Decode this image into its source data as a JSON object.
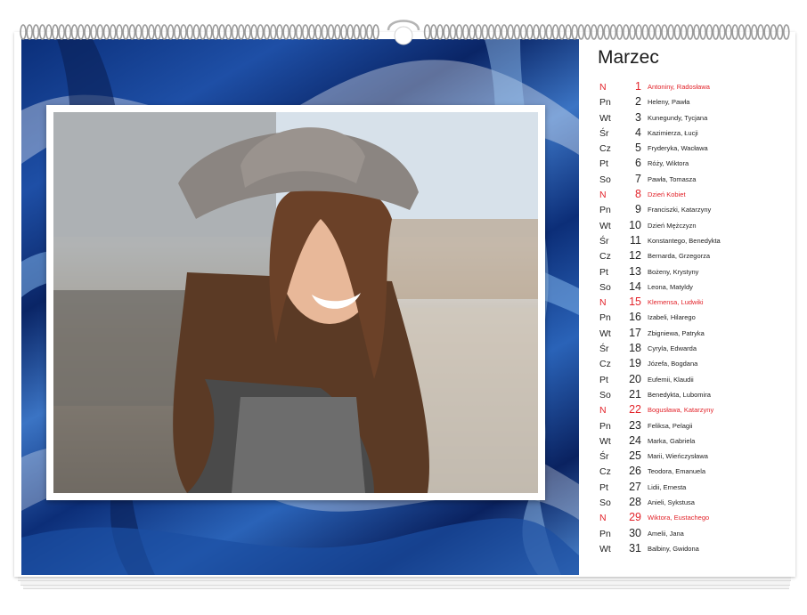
{
  "calendar": {
    "month": "Marzec",
    "days": [
      {
        "weekday": "N",
        "day": "1",
        "names": "Antoniny, Radosława",
        "holiday": true
      },
      {
        "weekday": "Pn",
        "day": "2",
        "names": "Heleny, Pawła",
        "holiday": false
      },
      {
        "weekday": "Wt",
        "day": "3",
        "names": "Kunegundy, Tycjana",
        "holiday": false
      },
      {
        "weekday": "Śr",
        "day": "4",
        "names": "Kazimierza, Łucji",
        "holiday": false
      },
      {
        "weekday": "Cz",
        "day": "5",
        "names": "Fryderyka, Wacława",
        "holiday": false
      },
      {
        "weekday": "Pt",
        "day": "6",
        "names": "Róży, Wiktora",
        "holiday": false
      },
      {
        "weekday": "So",
        "day": "7",
        "names": "Pawła, Tomasza",
        "holiday": false
      },
      {
        "weekday": "N",
        "day": "8",
        "names": "Dzień Kobiet",
        "holiday": true
      },
      {
        "weekday": "Pn",
        "day": "9",
        "names": "Franciszki, Katarzyny",
        "holiday": false
      },
      {
        "weekday": "Wt",
        "day": "10",
        "names": "Dzień Mężczyzn",
        "holiday": false
      },
      {
        "weekday": "Śr",
        "day": "11",
        "names": "Konstantego, Benedykta",
        "holiday": false
      },
      {
        "weekday": "Cz",
        "day": "12",
        "names": "Bernarda, Grzegorza",
        "holiday": false
      },
      {
        "weekday": "Pt",
        "day": "13",
        "names": "Bożeny, Krystyny",
        "holiday": false
      },
      {
        "weekday": "So",
        "day": "14",
        "names": "Leona, Matyldy",
        "holiday": false
      },
      {
        "weekday": "N",
        "day": "15",
        "names": "Klemensa, Ludwiki",
        "holiday": true
      },
      {
        "weekday": "Pn",
        "day": "16",
        "names": "Izabeli, Hilarego",
        "holiday": false
      },
      {
        "weekday": "Wt",
        "day": "17",
        "names": "Zbigniewa, Patryka",
        "holiday": false
      },
      {
        "weekday": "Śr",
        "day": "18",
        "names": "Cyryla, Edwarda",
        "holiday": false
      },
      {
        "weekday": "Cz",
        "day": "19",
        "names": "Józefa, Bogdana",
        "holiday": false
      },
      {
        "weekday": "Pt",
        "day": "20",
        "names": "Eufemii, Klaudii",
        "holiday": false
      },
      {
        "weekday": "So",
        "day": "21",
        "names": "Benedykta, Lubomira",
        "holiday": false
      },
      {
        "weekday": "N",
        "day": "22",
        "names": "Bogusława, Katarzyny",
        "holiday": true
      },
      {
        "weekday": "Pn",
        "day": "23",
        "names": "Feliksa, Pelagii",
        "holiday": false
      },
      {
        "weekday": "Wt",
        "day": "24",
        "names": "Marka, Gabriela",
        "holiday": false
      },
      {
        "weekday": "Śr",
        "day": "25",
        "names": "Marii, Wieńczysława",
        "holiday": false
      },
      {
        "weekday": "Cz",
        "day": "26",
        "names": "Teodora, Emanuela",
        "holiday": false
      },
      {
        "weekday": "Pt",
        "day": "27",
        "names": "Lidii, Ernesta",
        "holiday": false
      },
      {
        "weekday": "So",
        "day": "28",
        "names": "Anieli, Sykstusa",
        "holiday": false
      },
      {
        "weekday": "N",
        "day": "29",
        "names": "Wiktora, Eustachego",
        "holiday": true
      },
      {
        "weekday": "Pn",
        "day": "30",
        "names": "Amelii, Jana",
        "holiday": false
      },
      {
        "weekday": "Wt",
        "day": "31",
        "names": "Balbiny, Gwidona",
        "holiday": false
      }
    ]
  },
  "colors": {
    "holiday": "#e2232a",
    "text": "#222222",
    "marble_dark": "#0b2f7a",
    "marble_light": "#4d88d2"
  }
}
